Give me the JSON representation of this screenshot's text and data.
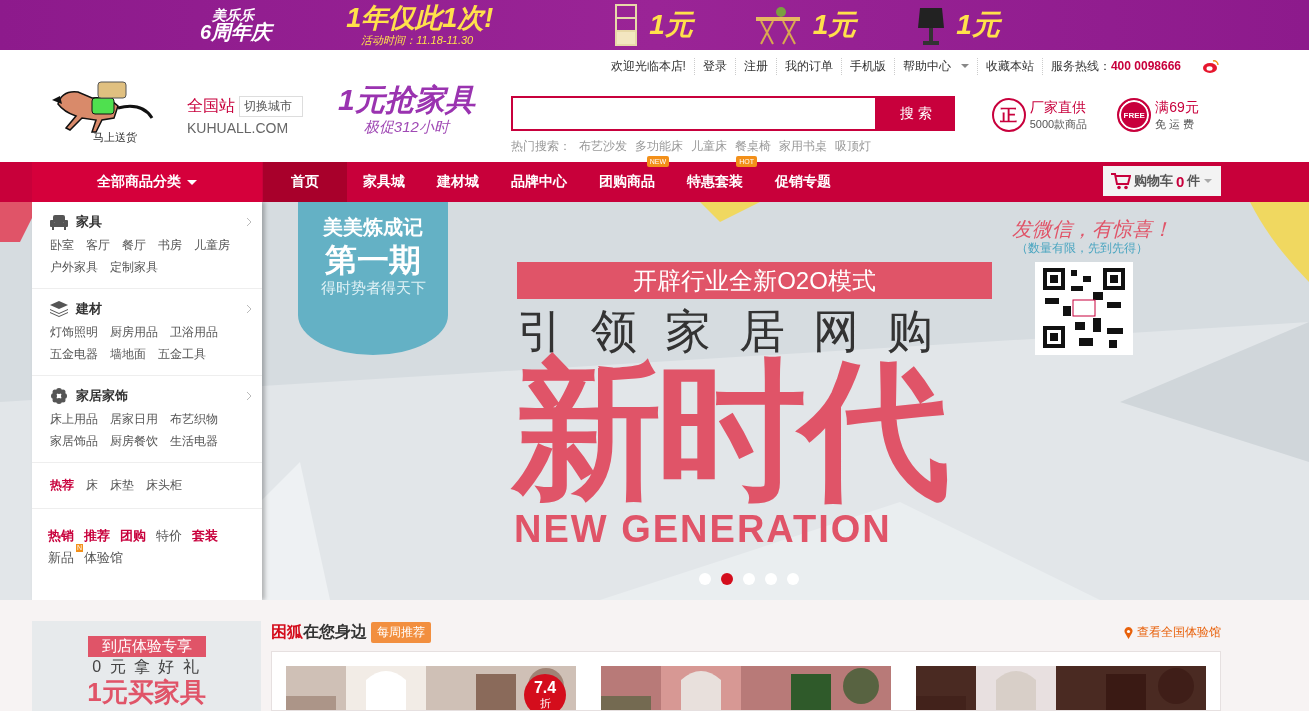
{
  "promo_banner": {
    "brand_top": "美乐乐",
    "brand_bottom": "6周年庆",
    "headline": "1年仅此1次!",
    "period": "活动时间：11.18-11.30",
    "offers": [
      {
        "kind": "shelf",
        "price": "1元"
      },
      {
        "kind": "table",
        "price": "1元"
      },
      {
        "kind": "lamp",
        "price": "1元"
      }
    ]
  },
  "top_links": [
    {
      "label": "欢迎光临本店!",
      "dropdown": false
    },
    {
      "label": "登录",
      "dropdown": false
    },
    {
      "label": "注册",
      "dropdown": false
    },
    {
      "label": "我的订单",
      "dropdown": false
    },
    {
      "label": "手机版",
      "dropdown": false
    },
    {
      "label": "帮助中心",
      "dropdown": true
    },
    {
      "label": "收藏本站",
      "dropdown": false
    }
  ],
  "hotline": {
    "label": "服务热线：",
    "number": "400 0098666"
  },
  "logo": {
    "caption": "马上送货"
  },
  "city": {
    "name": "全国站",
    "switch": "切换城市",
    "domain": "KUHUALL.COM"
  },
  "slogan": {
    "title": "1元抢家具",
    "subtitle": "极促312小时"
  },
  "search": {
    "button": "搜 索",
    "hot_label": "热门搜索：",
    "hot_terms": [
      "布艺沙发",
      "多功能床",
      "儿童床",
      "餐桌椅",
      "家用书桌",
      "吸顶灯"
    ]
  },
  "services": [
    {
      "kind": "genuine",
      "icon": "正",
      "title": "厂家直供",
      "subtitle": "5000款商品"
    },
    {
      "kind": "free",
      "icon": "FREE",
      "title": "满69元",
      "subtitle": "免 运 费"
    }
  ],
  "nav": {
    "all_categories": "全部商品分类",
    "items": [
      {
        "label": "首页",
        "selected": true
      },
      {
        "label": "家具城",
        "selected": false
      },
      {
        "label": "建材城",
        "selected": false
      },
      {
        "label": "品牌中心",
        "selected": false
      },
      {
        "label": "团购商品",
        "selected": false,
        "badge": "NEW"
      },
      {
        "label": "特惠套装",
        "selected": false,
        "badge": "HOT"
      },
      {
        "label": "促销专题",
        "selected": false
      }
    ],
    "cart": {
      "label": "购物车",
      "count": "0",
      "unit": "件"
    }
  },
  "category_menu": {
    "groups": [
      {
        "kind": "sofa",
        "title": "家具",
        "links": [
          "卧室",
          "客厅",
          "餐厅",
          "书房",
          "儿童房",
          "户外家具",
          "定制家具"
        ]
      },
      {
        "kind": "layers",
        "title": "建材",
        "links": [
          "灯饰照明",
          "厨房用品",
          "卫浴用品",
          "五金电器",
          "墙地面",
          "五金工具"
        ]
      },
      {
        "kind": "flower",
        "title": "家居家饰",
        "links": [
          "床上用品",
          "居家日用",
          "布艺织物",
          "家居饰品",
          "厨房餐饮",
          "生活电器"
        ]
      }
    ],
    "hot": {
      "label": "热荐",
      "links": [
        "床",
        "床垫",
        "床头柜"
      ]
    },
    "tags": [
      {
        "label": "热销",
        "highlight": true
      },
      {
        "label": "推荐",
        "highlight": true
      },
      {
        "label": "团购",
        "highlight": true
      },
      {
        "label": "特价",
        "highlight": false
      },
      {
        "label": "套装",
        "highlight": true
      },
      {
        "label": "新品",
        "highlight": false,
        "badge": "N"
      },
      {
        "label": "体验馆",
        "highlight": false
      }
    ]
  },
  "hero": {
    "ribbon": {
      "title": "美美炼成记",
      "issue": "第一期",
      "motto": "得时势者得天下"
    },
    "tagline": "开辟行业全新O2O模式",
    "headline": "引领家居网购",
    "big": "新时代",
    "english": "NEW GENERATION",
    "wechat": {
      "title": "发微信，有惊喜！",
      "note": "（数量有限，先到先得）"
    },
    "dots": [
      {
        "selected": false
      },
      {
        "selected": true
      },
      {
        "selected": false
      },
      {
        "selected": false
      },
      {
        "selected": false
      }
    ]
  },
  "store_promo": {
    "tag": "到店体验专享",
    "line": "0 元 拿 好 礼",
    "title": "1元买家具"
  },
  "nearby": {
    "brand": "困狐",
    "title": "在您身边",
    "tag": "每周推荐",
    "link": "查看全国体验馆",
    "products": [
      {
        "kind": "bright",
        "discount": "7.4",
        "discount_unit": "折"
      },
      {
        "kind": "rose"
      },
      {
        "kind": "dark"
      }
    ]
  }
}
